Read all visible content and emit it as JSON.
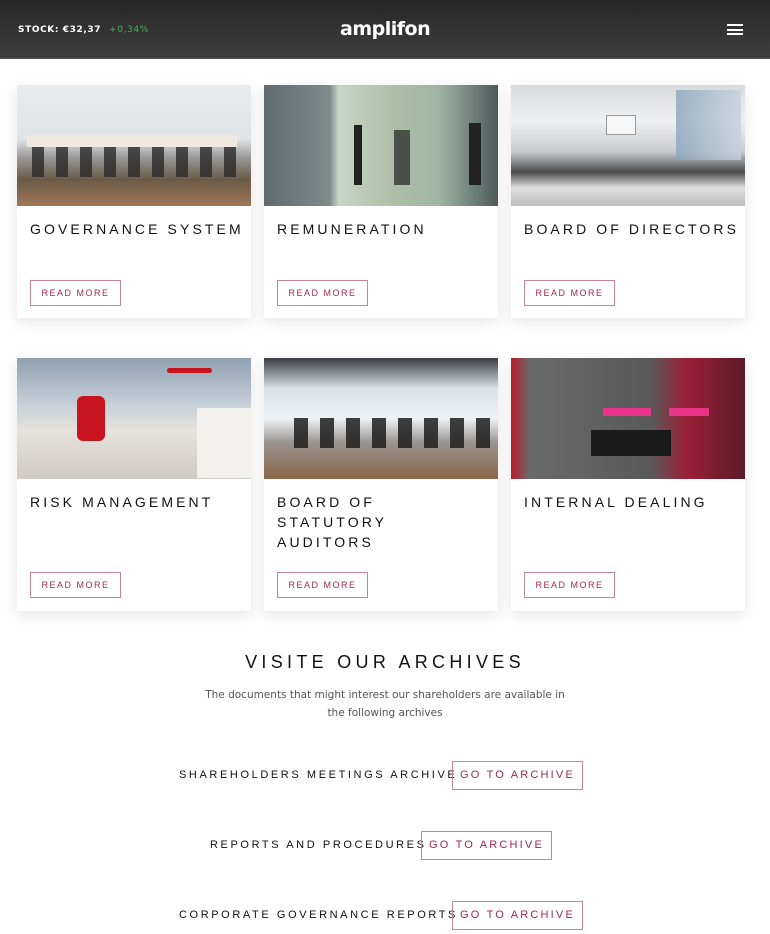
{
  "header": {
    "stock_label": "STOCK: €32,37",
    "stock_change": "+0,34%",
    "logo": "amplifon",
    "menu_icon": "hamburger-menu-icon"
  },
  "cards": [
    {
      "title": "GOVERNANCE SYSTEM",
      "button": "READ MORE",
      "image": "boardroom-with-long-table"
    },
    {
      "title": "REMUNERATION",
      "button": "READ MORE",
      "image": "people-walking-glass-office"
    },
    {
      "title": "BOARD OF DIRECTORS",
      "button": "READ MORE",
      "image": "conference-room-white-chairs"
    },
    {
      "title": "RISK MANAGEMENT",
      "button": "READ MORE",
      "image": "office-lounge-red-chair"
    },
    {
      "title": "BOARD OF STATUTORY AUDITORS",
      "button": "READ MORE",
      "image": "meeting-room-black-chairs"
    },
    {
      "title": "INTERNAL DEALING",
      "button": "READ MORE",
      "image": "amplifon-reception-pink-signs"
    }
  ],
  "archives": {
    "title": "VISITE OUR ARCHIVES",
    "description": "The documents that might interest our shareholders are available in the following archives",
    "items": [
      {
        "label": "SHAREHOLDERS MEETINGS ARCHIVE",
        "button": "GO TO ARCHIVE"
      },
      {
        "label": "REPORTS AND PROCEDURES",
        "button": "GO TO ARCHIVE"
      },
      {
        "label": "CORPORATE GOVERNANCE REPORTS",
        "button": "GO TO ARCHIVE"
      }
    ]
  },
  "colors": {
    "accent": "#a3294f",
    "stock_positive": "#4caf50",
    "header_bg": "#333333"
  }
}
